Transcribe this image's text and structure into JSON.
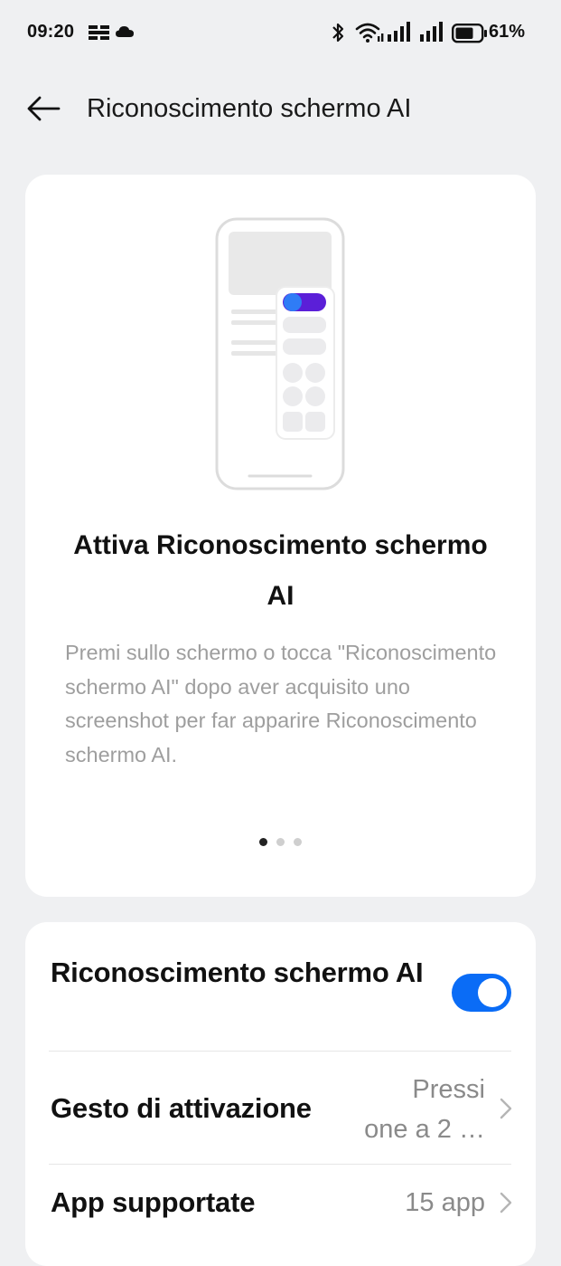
{
  "status_bar": {
    "time": "09:20",
    "battery_percent": "61%",
    "icons": [
      "notification-icon",
      "cloud-icon",
      "bluetooth-icon",
      "wifi-icon",
      "signal-icon",
      "signal-icon",
      "battery-icon"
    ]
  },
  "header": {
    "title": "Riconoscimento schermo AI",
    "back_icon": "back-arrow-icon"
  },
  "intro": {
    "title": "Attiva Riconoscimento schermo AI",
    "description": "Premi sullo schermo o tocca \"Riconoscimento schermo AI\" dopo aver acquisito uno screenshot per far apparire Riconoscimento schermo AI.",
    "page_count": 3,
    "active_page": 1
  },
  "settings": {
    "toggle_row": {
      "label": "Riconoscimento schermo AI",
      "enabled": true
    },
    "gesture_row": {
      "label": "Gesto di attivazione",
      "value": "Pressione a 2 …",
      "value_line1": "Pressi",
      "value_line2": "one a 2 …"
    },
    "apps_row": {
      "label": "App supportate",
      "value": "15 app"
    }
  },
  "colors": {
    "background": "#eff0f2",
    "card": "#ffffff",
    "accent": "#0a6cf6",
    "illustration_purple": "#5b1fd8",
    "secondary_text": "#9e9e9e"
  }
}
